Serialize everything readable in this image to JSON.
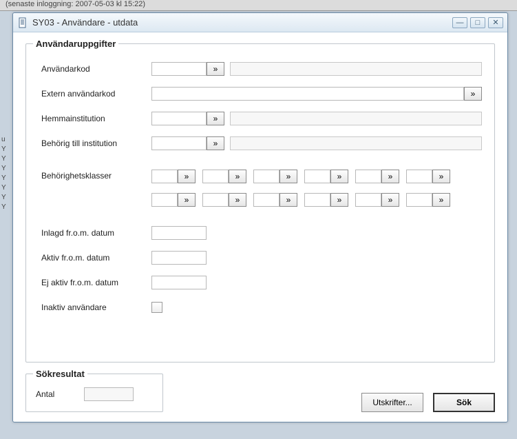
{
  "topbar_hint": "(senaste inloggning: 2007-05-03 kl 15:22)",
  "sidebar": {
    "u": "u",
    "y1": "Y",
    "y2": "Y",
    "y3": "Y",
    "y4": "Y",
    "y5": "Y",
    "y6": "Y",
    "y7": "Y"
  },
  "window": {
    "title": "SY03 - Användare - utdata"
  },
  "group": {
    "legend": "Användaruppgifter",
    "rows": {
      "anvandarkod_label": "Användarkod",
      "extern_label": "Extern användarkod",
      "hemma_label": "Hemmainstitution",
      "behorig_label": "Behörig till institution",
      "beh_klasser_label": "Behörighetsklasser",
      "inlagd_label": "Inlagd fr.o.m. datum",
      "aktiv_label": "Aktiv fr.o.m. datum",
      "ejaktiv_label": "Ej aktiv fr.o.m. datum",
      "inaktiv_label": "Inaktiv användare"
    },
    "values": {
      "anvandarkod": "",
      "anvandarkod_desc": "",
      "extern": "",
      "hemma": "",
      "hemma_desc": "",
      "behorig": "",
      "behorig_desc": "",
      "klasser": [
        [
          "",
          "",
          "",
          "",
          "",
          ""
        ],
        [
          "",
          "",
          "",
          "",
          "",
          ""
        ]
      ],
      "inlagd": "",
      "aktiv": "",
      "ejaktiv": "",
      "inaktiv_checked": false
    }
  },
  "result": {
    "legend": "Sökresultat",
    "antal_label": "Antal",
    "antal": ""
  },
  "buttons": {
    "utskrifter": "Utskrifter...",
    "sok": "Sök"
  },
  "glyphs": {
    "lookup": "»",
    "min": "—",
    "max": "□",
    "close": "✕"
  }
}
